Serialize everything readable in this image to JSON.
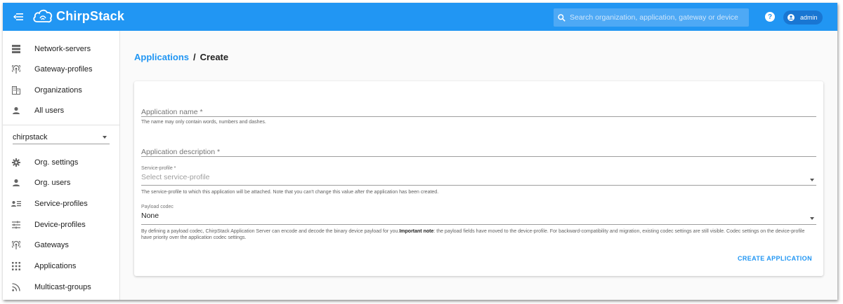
{
  "app": {
    "name": "ChirpStack"
  },
  "topbar": {
    "search_placeholder": "Search organization, application, gateway or device",
    "help_glyph": "?",
    "user": "admin"
  },
  "sidebar": {
    "admin_items": [
      {
        "label": "Network-servers",
        "icon": "server-icon"
      },
      {
        "label": "Gateway-profiles",
        "icon": "radio-tower-icon"
      },
      {
        "label": "Organizations",
        "icon": "building-icon"
      },
      {
        "label": "All users",
        "icon": "user-icon"
      }
    ],
    "org_select": {
      "value": "chirpstack"
    },
    "org_items": [
      {
        "label": "Org. settings",
        "icon": "gear-icon"
      },
      {
        "label": "Org. users",
        "icon": "user-icon"
      },
      {
        "label": "Service-profiles",
        "icon": "account-details-icon"
      },
      {
        "label": "Device-profiles",
        "icon": "tune-icon"
      },
      {
        "label": "Gateways",
        "icon": "radio-tower-icon"
      },
      {
        "label": "Applications",
        "icon": "apps-grid-icon"
      },
      {
        "label": "Multicast-groups",
        "icon": "rss-icon"
      }
    ]
  },
  "breadcrumb": {
    "parent": "Applications",
    "separator": "/",
    "current": "Create"
  },
  "form": {
    "app_name": {
      "label": "Application name *",
      "helper": "The name may only contain words, numbers and dashes."
    },
    "app_description": {
      "label": "Application description *"
    },
    "service_profile": {
      "label": "Service-profile *",
      "placeholder": "Select service-profile",
      "helper": "The service-profile to which this application will be attached. Note that you can't change this value after the application has been created."
    },
    "payload_codec": {
      "label": "Payload codec",
      "value": "None",
      "helper_pre": "By defining a payload codec, ChirpStack Application Server can encode and decode the binary device payload for you.",
      "helper_bold": "Important note",
      "helper_post": ": the payload fields have moved to the device-profile. For backward-compatibility and migration, existing codec settings are still visible. Codec settings on the device-profile have priority over the application codec settings."
    },
    "submit_label": "CREATE APPLICATION"
  },
  "colors": {
    "primary": "#2196f3",
    "chip": "#1976d2"
  }
}
